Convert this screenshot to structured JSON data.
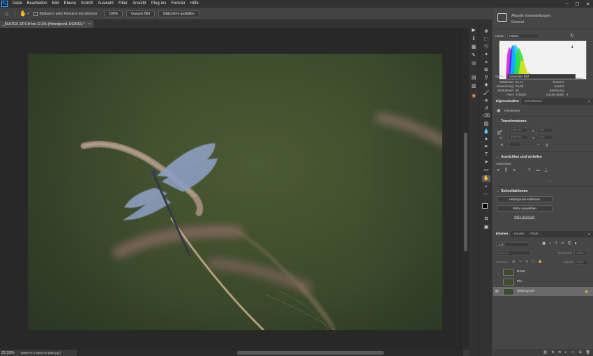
{
  "menubar": {
    "logo": "Ps",
    "items": [
      "Datei",
      "Bearbeiten",
      "Bild",
      "Ebene",
      "Schrift",
      "Auswahl",
      "Filter",
      "Ansicht",
      "Plug-ins",
      "Fenster",
      "Hilfe"
    ]
  },
  "options": {
    "scroll_all_label": "Bildlauf in allen Fenstern durchführen",
    "zoom_100": "100%",
    "fit_label": "Ganzes Bild",
    "fill_screen_label": "Bildschirm ausfüllen"
  },
  "document": {
    "tab_title": "_56A7621-DP3.tif bei 22,3% (Hintergrund, RGB/16) *",
    "close_glyph": "×"
  },
  "status": {
    "zoom": "22,33%",
    "info": "6000 Px x 4000 Px (300 ppi)",
    "arrow": "›"
  },
  "histogram": {
    "preset_title": "Aktuelle Voreinstellungen:",
    "preset_name": "General",
    "channel_label": "Kanal:",
    "channel_value": "Farben",
    "source_label": "Quelle:",
    "source_value": "Gesamtes Bild",
    "stats_left": [
      {
        "label": "Mittelwert:",
        "value": "61,17"
      },
      {
        "label": "Abweichung:",
        "value": "24,36"
      },
      {
        "label": "Zentralwert:",
        "value": "62"
      },
      {
        "label": "Pixel:",
        "value": "375000"
      }
    ],
    "stats_right": [
      {
        "label": "Tonwert:"
      },
      {
        "label": "Anzahl:"
      },
      {
        "label": "Spreizung:"
      },
      {
        "label": "Cache-Stufe:",
        "value": "4"
      }
    ]
  },
  "properties": {
    "tabs": [
      "Eigenschaften",
      "Korrekturen"
    ],
    "layer_type": "Pixelebene",
    "transform_title": "Transformieren",
    "transform_fields": [
      "6000 Px",
      "0 Px",
      "4000 Px",
      "0 Px"
    ],
    "transform_units": [
      "B",
      "X",
      "H",
      "Y"
    ],
    "align_title": "Ausrichten und verteilen",
    "align_label": "Ausrichten:",
    "quick_title": "Schnellaktionen",
    "btn_remove_bg": "Hintergrund entfernen",
    "btn_select_subject": "Motiv auswählen",
    "more_link": "Mehr anzeigen"
  },
  "layers": {
    "tabs": [
      "Ebenen",
      "Kanäle",
      "Pfade"
    ],
    "filter_label": "Art",
    "blend_mode": "Normal",
    "opacity_label": "Deckkraft:",
    "opacity_value": "100%",
    "lock_label": "Fixieren:",
    "fill_label": "Fläche:",
    "fill_value": "100%",
    "items": [
      {
        "name": "RAW",
        "visible": false
      },
      {
        "name": "Pin",
        "visible": false
      },
      {
        "name": "Hintergrund",
        "visible": true
      }
    ],
    "footer_icons": [
      "link-icon",
      "fx-icon",
      "mask-icon",
      "adjustment-icon",
      "group-icon",
      "new-layer-icon",
      "trash-icon"
    ],
    "footer_glyphs": [
      "⛓",
      "fx",
      "◘",
      "◐",
      "▭",
      "⊞",
      "🗑"
    ]
  },
  "colors": {
    "accent": "#31a8ff",
    "panel_bg": "#464646",
    "canvas_bg": "#282828"
  }
}
